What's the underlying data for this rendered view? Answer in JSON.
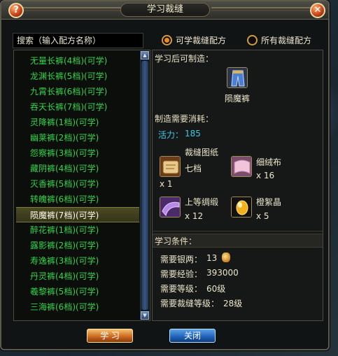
{
  "window": {
    "title": "学习裁缝"
  },
  "titlebar": {
    "help_label": "?",
    "close_label": "✕"
  },
  "search": {
    "placeholder": "搜索（输入配方名称）"
  },
  "filters": [
    {
      "label": "可学裁缝配方",
      "selected": true
    },
    {
      "label": "所有裁缝配方",
      "selected": false
    }
  ],
  "recipe_list": [
    {
      "label": "无量长裤(4档)(可学)"
    },
    {
      "label": "龙渊长裤(5档)(可学)"
    },
    {
      "label": "九霄长裤(6档)(可学)"
    },
    {
      "label": "吞天长裤(7档)(可学)"
    },
    {
      "label": "灵降裤(1档)(可学)"
    },
    {
      "label": "幽莱裤(2档)(可学)"
    },
    {
      "label": "怨察裤(3档)(可学)"
    },
    {
      "label": "藏阴裤(4档)(可学)"
    },
    {
      "label": "灭香裤(5档)(可学)"
    },
    {
      "label": "转魄裤(6档)(可学)"
    },
    {
      "label": "陨魔裤(7档)(可学)",
      "selected": true
    },
    {
      "label": "醉花裤(1档)(可学)"
    },
    {
      "label": "露影裤(2档)(可学)"
    },
    {
      "label": "寿逸裤(3档)(可学)"
    },
    {
      "label": "丹灵裤(4档)(可学)"
    },
    {
      "label": "羲黎裤(5档)(可学)"
    },
    {
      "label": "三海裤(6档)(可学)"
    }
  ],
  "detail": {
    "can_make_label": "学习后可制造：",
    "product_name": "陨魔裤",
    "cost_label": "制造需要消耗：",
    "vitality_label": "活力：",
    "vitality_value": "185",
    "materials": [
      {
        "name_line1": "裁缝图纸",
        "name_line2": "七档",
        "qty": "x 1",
        "icon": "pattern-scroll-icon"
      },
      {
        "name_line1": "细绒布",
        "name_line2": "",
        "qty": "x 16",
        "icon": "fine-cloth-icon"
      },
      {
        "name_line1": "上等绸缎",
        "name_line2": "",
        "qty": "x 12",
        "icon": "silk-icon"
      },
      {
        "name_line1": "橙絮晶",
        "name_line2": "",
        "qty": "x 5",
        "icon": "orange-crystal-icon"
      }
    ],
    "conditions_label": "学习条件：",
    "req_silver_label": "需要银两：",
    "req_silver_value": "13",
    "req_exp_label": "需要经验：",
    "req_exp_value": "393000",
    "req_level_label": "需要等级：",
    "req_level_value": "60级",
    "req_tailor_label": "需要裁缝等级：",
    "req_tailor_value": "28级"
  },
  "buttons": {
    "learn": "学 习",
    "close": "关闭"
  },
  "colors": {
    "list_text": "#35d34a",
    "accent_orange": "#f08a1a",
    "cyan_text": "#43c7e6"
  }
}
